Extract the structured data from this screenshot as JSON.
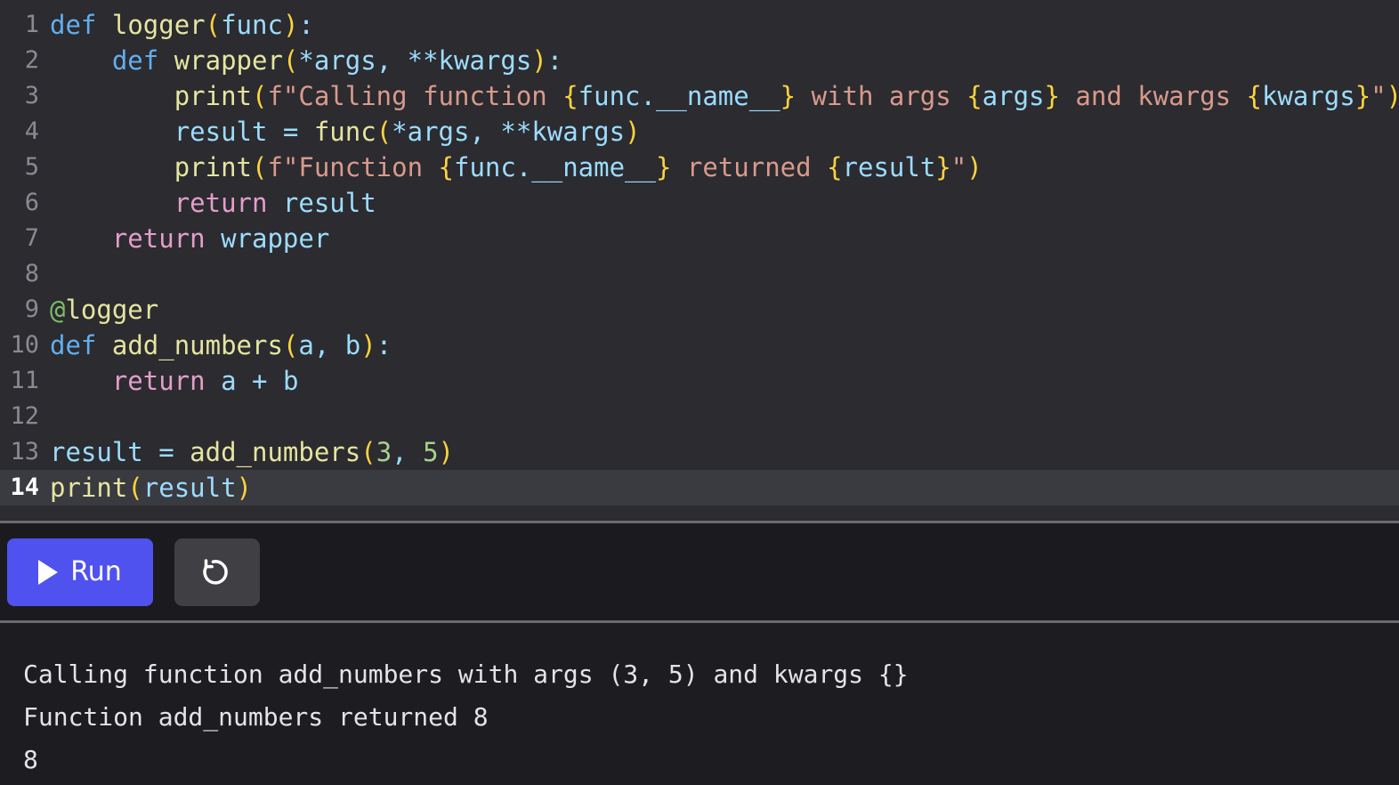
{
  "editor": {
    "language": "python",
    "active_line": 14,
    "lines": [
      {
        "num": "1",
        "tokens": [
          {
            "t": "def",
            "c": "t-kw"
          },
          {
            "t": " ",
            "c": "t-plain"
          },
          {
            "t": "logger",
            "c": "t-fn"
          },
          {
            "t": "(",
            "c": "t-punc"
          },
          {
            "t": "func",
            "c": "t-var"
          },
          {
            "t": ")",
            "c": "t-punc"
          },
          {
            "t": ":",
            "c": "t-op"
          }
        ]
      },
      {
        "num": "2",
        "tokens": [
          {
            "t": "    ",
            "c": "t-plain"
          },
          {
            "t": "def",
            "c": "t-kw"
          },
          {
            "t": " ",
            "c": "t-plain"
          },
          {
            "t": "wrapper",
            "c": "t-fn"
          },
          {
            "t": "(",
            "c": "t-punc"
          },
          {
            "t": "*",
            "c": "t-op"
          },
          {
            "t": "args",
            "c": "t-var"
          },
          {
            "t": ", ",
            "c": "t-op"
          },
          {
            "t": "**",
            "c": "t-op"
          },
          {
            "t": "kwargs",
            "c": "t-var"
          },
          {
            "t": ")",
            "c": "t-punc"
          },
          {
            "t": ":",
            "c": "t-op"
          }
        ]
      },
      {
        "num": "3",
        "tokens": [
          {
            "t": "        ",
            "c": "t-plain"
          },
          {
            "t": "print",
            "c": "t-fn"
          },
          {
            "t": "(",
            "c": "t-punc"
          },
          {
            "t": "f\"Calling function ",
            "c": "t-str"
          },
          {
            "t": "{",
            "c": "t-punc"
          },
          {
            "t": "func.__name__",
            "c": "t-var"
          },
          {
            "t": "}",
            "c": "t-punc"
          },
          {
            "t": " with args ",
            "c": "t-str"
          },
          {
            "t": "{",
            "c": "t-punc"
          },
          {
            "t": "args",
            "c": "t-var"
          },
          {
            "t": "}",
            "c": "t-punc"
          },
          {
            "t": " and kwargs ",
            "c": "t-str"
          },
          {
            "t": "{",
            "c": "t-punc"
          },
          {
            "t": "kwargs",
            "c": "t-var"
          },
          {
            "t": "}",
            "c": "t-punc"
          },
          {
            "t": "\"",
            "c": "t-str"
          },
          {
            "t": ")",
            "c": "t-punc"
          }
        ]
      },
      {
        "num": "4",
        "tokens": [
          {
            "t": "        ",
            "c": "t-plain"
          },
          {
            "t": "result",
            "c": "t-var"
          },
          {
            "t": " = ",
            "c": "t-op"
          },
          {
            "t": "func",
            "c": "t-fn"
          },
          {
            "t": "(",
            "c": "t-punc"
          },
          {
            "t": "*",
            "c": "t-op"
          },
          {
            "t": "args",
            "c": "t-var"
          },
          {
            "t": ", ",
            "c": "t-op"
          },
          {
            "t": "**",
            "c": "t-op"
          },
          {
            "t": "kwargs",
            "c": "t-var"
          },
          {
            "t": ")",
            "c": "t-punc"
          }
        ]
      },
      {
        "num": "5",
        "tokens": [
          {
            "t": "        ",
            "c": "t-plain"
          },
          {
            "t": "print",
            "c": "t-fn"
          },
          {
            "t": "(",
            "c": "t-punc"
          },
          {
            "t": "f\"Function ",
            "c": "t-str"
          },
          {
            "t": "{",
            "c": "t-punc"
          },
          {
            "t": "func.__name__",
            "c": "t-var"
          },
          {
            "t": "}",
            "c": "t-punc"
          },
          {
            "t": " returned ",
            "c": "t-str"
          },
          {
            "t": "{",
            "c": "t-punc"
          },
          {
            "t": "result",
            "c": "t-var"
          },
          {
            "t": "}",
            "c": "t-punc"
          },
          {
            "t": "\"",
            "c": "t-str"
          },
          {
            "t": ")",
            "c": "t-punc"
          }
        ]
      },
      {
        "num": "6",
        "tokens": [
          {
            "t": "        ",
            "c": "t-plain"
          },
          {
            "t": "return",
            "c": "t-kw2"
          },
          {
            "t": " ",
            "c": "t-plain"
          },
          {
            "t": "result",
            "c": "t-var"
          }
        ]
      },
      {
        "num": "7",
        "tokens": [
          {
            "t": "    ",
            "c": "t-plain"
          },
          {
            "t": "return",
            "c": "t-kw2"
          },
          {
            "t": " ",
            "c": "t-plain"
          },
          {
            "t": "wrapper",
            "c": "t-var"
          }
        ]
      },
      {
        "num": "8",
        "tokens": []
      },
      {
        "num": "9",
        "tokens": [
          {
            "t": "@",
            "c": "t-dec"
          },
          {
            "t": "logger",
            "c": "t-fn"
          }
        ]
      },
      {
        "num": "10",
        "tokens": [
          {
            "t": "def",
            "c": "t-kw"
          },
          {
            "t": " ",
            "c": "t-plain"
          },
          {
            "t": "add_numbers",
            "c": "t-fn"
          },
          {
            "t": "(",
            "c": "t-punc"
          },
          {
            "t": "a",
            "c": "t-var"
          },
          {
            "t": ", ",
            "c": "t-op"
          },
          {
            "t": "b",
            "c": "t-var"
          },
          {
            "t": ")",
            "c": "t-punc"
          },
          {
            "t": ":",
            "c": "t-op"
          }
        ]
      },
      {
        "num": "11",
        "tokens": [
          {
            "t": "    ",
            "c": "t-plain"
          },
          {
            "t": "return",
            "c": "t-kw2"
          },
          {
            "t": " ",
            "c": "t-plain"
          },
          {
            "t": "a",
            "c": "t-var"
          },
          {
            "t": " + ",
            "c": "t-op"
          },
          {
            "t": "b",
            "c": "t-var"
          }
        ]
      },
      {
        "num": "12",
        "tokens": []
      },
      {
        "num": "13",
        "tokens": [
          {
            "t": "result",
            "c": "t-var"
          },
          {
            "t": " = ",
            "c": "t-op"
          },
          {
            "t": "add_numbers",
            "c": "t-fn"
          },
          {
            "t": "(",
            "c": "t-punc"
          },
          {
            "t": "3",
            "c": "t-num"
          },
          {
            "t": ", ",
            "c": "t-op"
          },
          {
            "t": "5",
            "c": "t-num"
          },
          {
            "t": ")",
            "c": "t-punc"
          }
        ]
      },
      {
        "num": "14",
        "active": true,
        "tokens": [
          {
            "t": "print",
            "c": "t-fn"
          },
          {
            "t": "(",
            "c": "t-punc"
          },
          {
            "t": "result",
            "c": "t-var"
          },
          {
            "t": ")",
            "c": "t-punc"
          }
        ]
      }
    ],
    "source_text": "def logger(func):\n    def wrapper(*args, **kwargs):\n        print(f\"Calling function {func.__name__} with args {args} and kwargs {kwargs}\")\n        result = func(*args, **kwargs)\n        print(f\"Function {func.__name__} returned {result}\")\n        return result\n    return wrapper\n\n@logger\ndef add_numbers(a, b):\n    return a + b\n\nresult = add_numbers(3, 5)\nprint(result)"
  },
  "toolbar": {
    "run_label": "Run",
    "reset_label": "",
    "run_color": "#4f52ee",
    "reset_color": "#3f3f44"
  },
  "output": {
    "lines": [
      "Calling function add_numbers with args (3, 5) and kwargs {}",
      "Function add_numbers returned 8",
      "8"
    ]
  }
}
